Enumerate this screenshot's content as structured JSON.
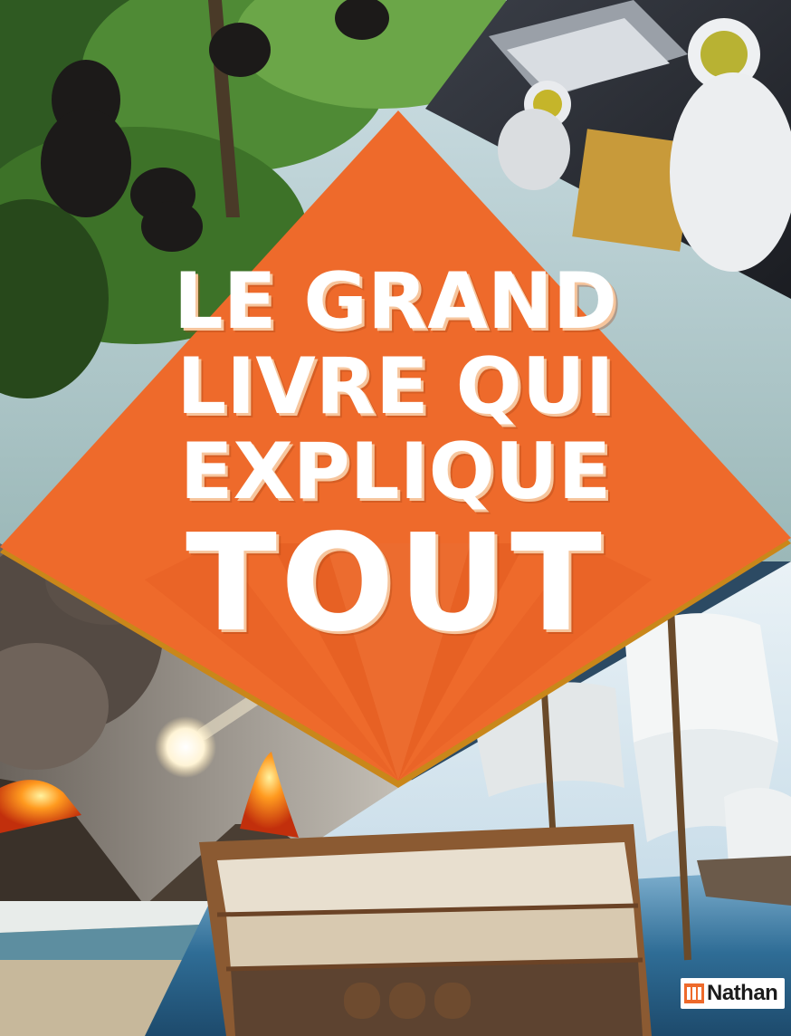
{
  "cover": {
    "title_lines": [
      "LE GRAND",
      "LIVRE QUI",
      "EXPLIQUE",
      "TOUT"
    ],
    "publisher": "Nathan",
    "colors": {
      "banner": "#ee6a2b",
      "banner_light": "#f5884a",
      "banner_dark": "#d9531c",
      "title_text": "#ffffff",
      "title_shadow": "#f6c59d"
    },
    "illustrations": [
      "chimpanzees-in-jungle",
      "astronauts-at-space-station",
      "erupting-volcanoes-and-meteor",
      "cutaway-sailing-ship-at-sea"
    ]
  }
}
